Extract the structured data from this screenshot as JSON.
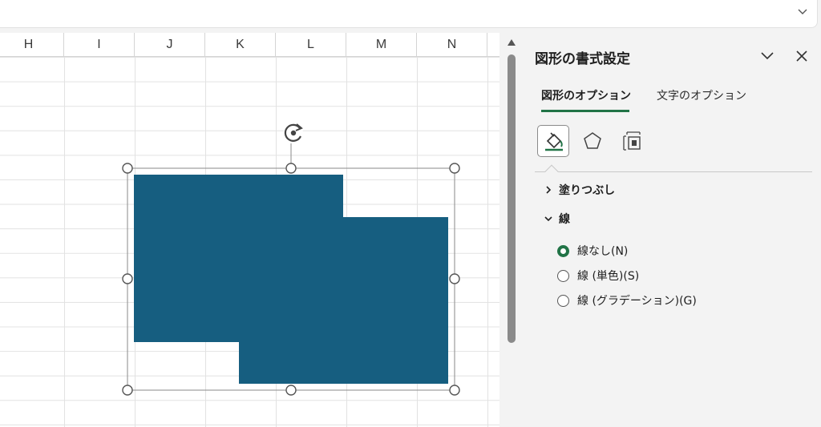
{
  "columns": [
    "H",
    "I",
    "J",
    "K",
    "L",
    "M",
    "N"
  ],
  "shape_fill_color": "#165E80",
  "pane": {
    "title": "図形の書式設定",
    "tabs": [
      {
        "label": "図形のオプション",
        "active": true
      },
      {
        "label": "文字のオプション",
        "active": false
      }
    ],
    "icons": [
      "fill-line-icon",
      "effects-pentagon-icon",
      "size-properties-icon"
    ],
    "sections": [
      {
        "label": "塗りつぶし",
        "expanded": false
      },
      {
        "label": "線",
        "expanded": true
      }
    ],
    "line_options": [
      {
        "label": "線なし(N)",
        "checked": true
      },
      {
        "label": "線 (単色)(S)",
        "checked": false
      },
      {
        "label": "線 (グラデーション)(G)",
        "checked": false
      }
    ]
  },
  "colors": {
    "accent": "#217346",
    "pane_bg": "#F3F3F3"
  }
}
